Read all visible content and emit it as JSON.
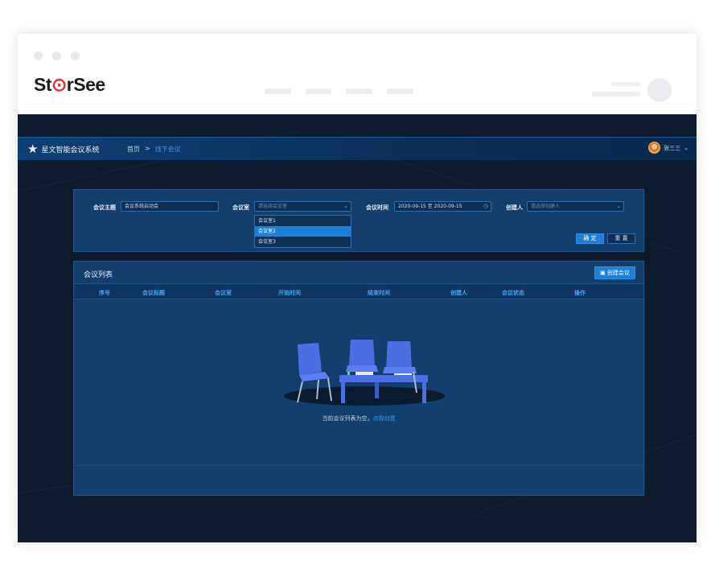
{
  "brand": {
    "name_prefix": "St",
    "name_ring": "⊙",
    "name_r": "r",
    "name_suffix": "See"
  },
  "app": {
    "system_name": "星文智能会议系统",
    "breadcrumb": {
      "home": "首页",
      "separator": ">",
      "current": "线下会议"
    },
    "user": {
      "name": "张三三",
      "caret": "⌄"
    }
  },
  "filter": {
    "topic_label": "会议主题",
    "topic_value": "会议系统启动会",
    "room_label": "会议室",
    "room_placeholder": "请选择会议室",
    "room_options": [
      "会议室1",
      "会议室2",
      "会议室3"
    ],
    "room_active_index": 1,
    "time_label": "会议时间",
    "time_value": "2020-09-15 至 2020-09-15",
    "creator_label": "创建人",
    "creator_placeholder": "请选择创建人",
    "confirm_label": "确 定",
    "reset_label": "重 置"
  },
  "list": {
    "title": "会议列表",
    "create_label": "创建会议",
    "columns": [
      "序号",
      "会议标题",
      "会议室",
      "开始时间",
      "结束时间",
      "创建人",
      "会议状态",
      "操作"
    ],
    "empty_text": "当前会议列表为空，",
    "empty_link": "点我创建"
  },
  "colors": {
    "app_bg": "#0e1b2d",
    "panel_bg": "#123f6e",
    "accent": "#1f7fd4",
    "header_text": "#4aa2ee",
    "chair": "#4a6fe3"
  },
  "icons": [
    "star-icon",
    "chevron-down-icon",
    "clock-icon",
    "document-plus-icon",
    "avatar-icon"
  ]
}
